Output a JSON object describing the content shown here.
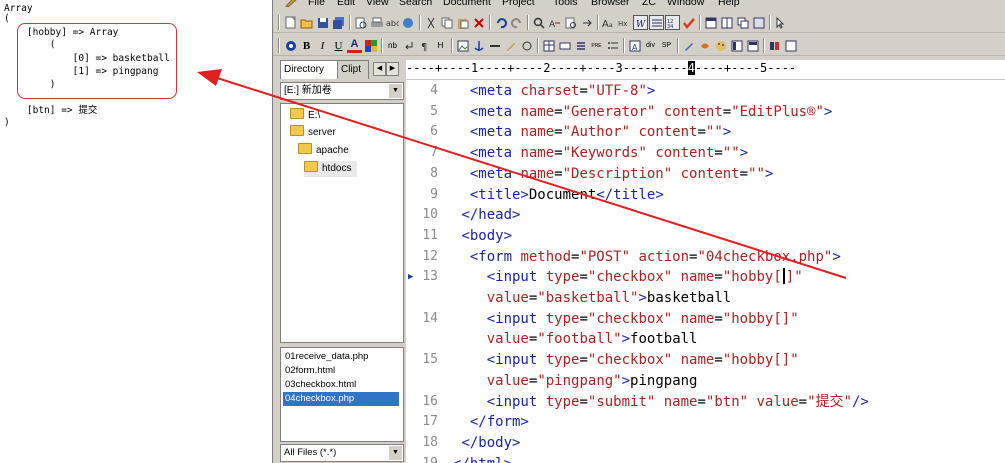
{
  "output": {
    "lines": [
      "Array",
      "(",
      "    [hobby] => Array",
      "        (",
      "            [0] => basketball",
      "            [1] => pingpang",
      "        )",
      "",
      "    [btn] => 提交",
      ")"
    ],
    "highlight_color": "#d93030"
  },
  "menubar": {
    "items": [
      "File",
      "Edit",
      "View",
      "Search",
      "Document",
      "Project",
      "Tools",
      "Browser",
      "ZC",
      "Window",
      "Help"
    ]
  },
  "toolbar2": {
    "bold": "B",
    "italic": "I",
    "underline": "U",
    "font_color": "A",
    "nbsp": "nb",
    "hr": "H",
    "pre": "PRE",
    "div": "div",
    "sp": "SP"
  },
  "directory": {
    "tabs": [
      "Directory",
      "Clipt"
    ],
    "drive": "[E:] 新加卷",
    "tree": [
      "E:\\",
      "server",
      "apache",
      "htdocs"
    ],
    "files": [
      "01receive_data.php",
      "02form.html",
      "03checkbox.html",
      "04checkbox.php"
    ],
    "selected_file": "04checkbox.php",
    "filter": "All Files (*.*)"
  },
  "ruler": {
    "text": "----+----1----+----2----+----3----+----4----+----5----",
    "cursor_column": "4"
  },
  "code": {
    "current_line": 13,
    "line_numbers": [
      "4",
      "5",
      "6",
      "7",
      "8",
      "9",
      "10",
      "11",
      "12",
      "13",
      "",
      "14",
      "",
      "15",
      "",
      "16",
      "17",
      "18",
      "19"
    ],
    "lines": [
      [
        [
          "  ",
          "p"
        ],
        [
          "<meta ",
          "t"
        ],
        [
          "charset",
          "a"
        ],
        [
          "=",
          "p"
        ],
        [
          "\"UTF-8\"",
          "v"
        ],
        [
          ">",
          "t"
        ]
      ],
      [
        [
          "  ",
          "p"
        ],
        [
          "<meta ",
          "t"
        ],
        [
          "name",
          "a"
        ],
        [
          "=",
          "p"
        ],
        [
          "\"Generator\"",
          "v"
        ],
        [
          " content",
          "a"
        ],
        [
          "=",
          "p"
        ],
        [
          "\"EditPlus®\"",
          "v"
        ],
        [
          ">",
          "t"
        ]
      ],
      [
        [
          "  ",
          "p"
        ],
        [
          "<meta ",
          "t"
        ],
        [
          "name",
          "a"
        ],
        [
          "=",
          "p"
        ],
        [
          "\"Author\"",
          "v"
        ],
        [
          " content",
          "a"
        ],
        [
          "=",
          "p"
        ],
        [
          "\"\"",
          "v"
        ],
        [
          ">",
          "t"
        ]
      ],
      [
        [
          "  ",
          "p"
        ],
        [
          "<meta ",
          "t"
        ],
        [
          "name",
          "a"
        ],
        [
          "=",
          "p"
        ],
        [
          "\"Keywords\"",
          "v"
        ],
        [
          " content",
          "a"
        ],
        [
          "=",
          "p"
        ],
        [
          "\"\"",
          "v"
        ],
        [
          ">",
          "t"
        ]
      ],
      [
        [
          "  ",
          "p"
        ],
        [
          "<meta ",
          "t"
        ],
        [
          "name",
          "a"
        ],
        [
          "=",
          "p"
        ],
        [
          "\"Description\"",
          "v"
        ],
        [
          " content",
          "a"
        ],
        [
          "=",
          "p"
        ],
        [
          "\"\"",
          "v"
        ],
        [
          ">",
          "t"
        ]
      ],
      [
        [
          "  ",
          "p"
        ],
        [
          "<title>",
          "t"
        ],
        [
          "Document",
          "p"
        ],
        [
          "</title>",
          "t"
        ]
      ],
      [
        [
          " ",
          "p"
        ],
        [
          "</head>",
          "t"
        ]
      ],
      [
        [
          " ",
          "p"
        ],
        [
          "<body>",
          "t"
        ]
      ],
      [
        [
          "  ",
          "p"
        ],
        [
          "<form ",
          "t"
        ],
        [
          "method",
          "a"
        ],
        [
          "=",
          "p"
        ],
        [
          "\"POST\"",
          "v"
        ],
        [
          " action",
          "a"
        ],
        [
          "=",
          "p"
        ],
        [
          "\"04checkbox.php\"",
          "v"
        ],
        [
          ">",
          "t"
        ]
      ],
      [
        [
          "    ",
          "p"
        ],
        [
          "<input ",
          "t"
        ],
        [
          "type",
          "a"
        ],
        [
          "=",
          "p"
        ],
        [
          "\"checkbox\"",
          "v"
        ],
        [
          " name",
          "a"
        ],
        [
          "=",
          "p"
        ],
        [
          "\"hobby[",
          "v"
        ],
        [
          "|",
          "caret"
        ],
        [
          "]\"",
          "v"
        ]
      ],
      [
        [
          "    ",
          "p"
        ],
        [
          "value",
          "a"
        ],
        [
          "=",
          "p"
        ],
        [
          "\"basketball\"",
          "v"
        ],
        [
          ">",
          "t"
        ],
        [
          "basketball",
          "p"
        ]
      ],
      [
        [
          "    ",
          "p"
        ],
        [
          "<input ",
          "t"
        ],
        [
          "type",
          "a"
        ],
        [
          "=",
          "p"
        ],
        [
          "\"checkbox\"",
          "v"
        ],
        [
          " name",
          "a"
        ],
        [
          "=",
          "p"
        ],
        [
          "\"hobby[]\"",
          "v"
        ]
      ],
      [
        [
          "    ",
          "p"
        ],
        [
          "value",
          "a"
        ],
        [
          "=",
          "p"
        ],
        [
          "\"football\"",
          "v"
        ],
        [
          ">",
          "t"
        ],
        [
          "football",
          "p"
        ]
      ],
      [
        [
          "    ",
          "p"
        ],
        [
          "<input ",
          "t"
        ],
        [
          "type",
          "a"
        ],
        [
          "=",
          "p"
        ],
        [
          "\"checkbox\"",
          "v"
        ],
        [
          " name",
          "a"
        ],
        [
          "=",
          "p"
        ],
        [
          "\"hobby[]\"",
          "v"
        ]
      ],
      [
        [
          "    ",
          "p"
        ],
        [
          "value",
          "a"
        ],
        [
          "=",
          "p"
        ],
        [
          "\"pingpang\"",
          "v"
        ],
        [
          ">",
          "t"
        ],
        [
          "pingpang",
          "p"
        ]
      ],
      [
        [
          "    ",
          "p"
        ],
        [
          "<input ",
          "t"
        ],
        [
          "type",
          "a"
        ],
        [
          "=",
          "p"
        ],
        [
          "\"submit\"",
          "v"
        ],
        [
          " name",
          "a"
        ],
        [
          "=",
          "p"
        ],
        [
          "\"btn\"",
          "v"
        ],
        [
          " value",
          "a"
        ],
        [
          "=",
          "p"
        ],
        [
          "\"提交\"",
          "v"
        ],
        [
          "/>",
          "t"
        ]
      ],
      [
        [
          "  ",
          "p"
        ],
        [
          "</form>",
          "t"
        ]
      ],
      [
        [
          " ",
          "p"
        ],
        [
          "</body>",
          "t"
        ]
      ],
      [
        [
          "",
          "p"
        ],
        [
          "</html>",
          "t"
        ]
      ]
    ]
  },
  "annotation": {
    "arrow_color": "#e02020"
  }
}
